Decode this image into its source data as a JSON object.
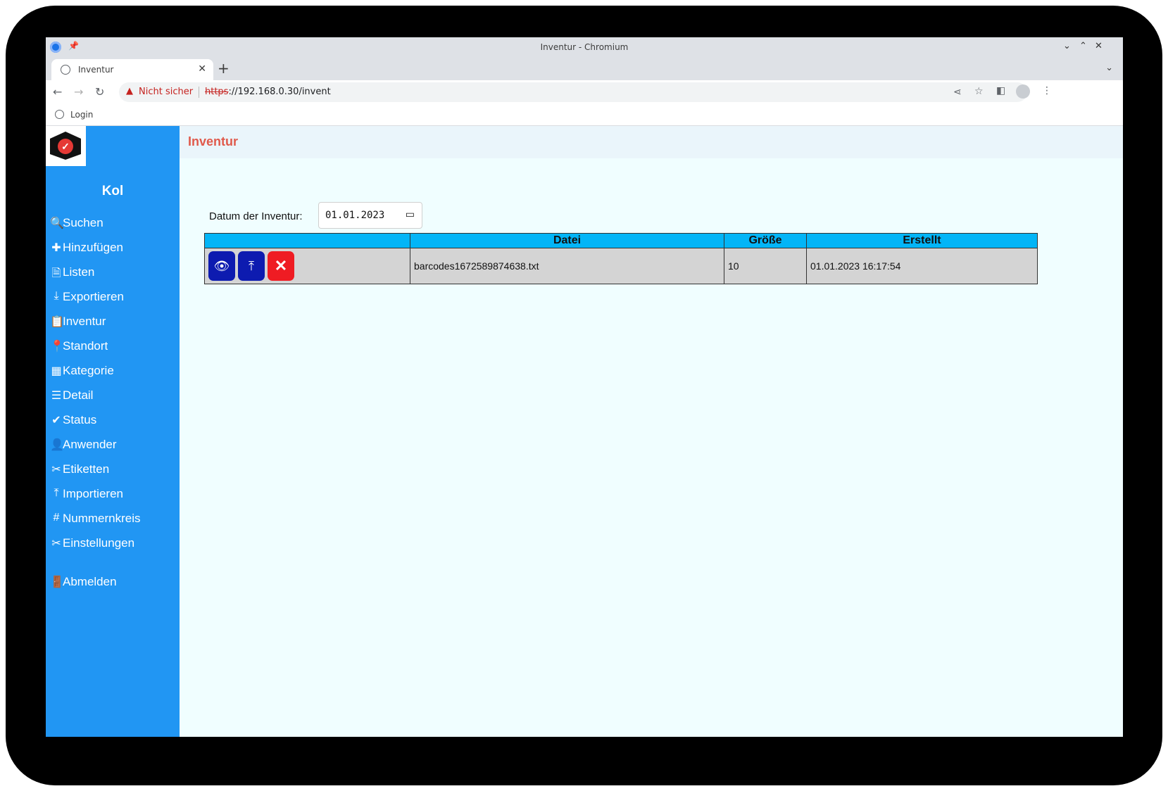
{
  "browser": {
    "window_title": "Inventur - Chromium",
    "tab_title": "Inventur",
    "security_label": "Nicht sicher",
    "url_scheme": "https",
    "url_rest": "://192.168.0.30/invent",
    "bookmark": "Login"
  },
  "sidebar": {
    "brand": "Kol",
    "items": [
      {
        "label": "Suchen",
        "icon": "search-icon",
        "glyph": "🔍"
      },
      {
        "label": "Hinzufügen",
        "icon": "plus-icon",
        "glyph": "✚"
      },
      {
        "label": "Listen",
        "icon": "document-icon",
        "glyph": "🗎"
      },
      {
        "label": "Exportieren",
        "icon": "download-icon",
        "glyph": "⤓"
      },
      {
        "label": "Inventur",
        "icon": "clipboard-icon",
        "glyph": "📋"
      },
      {
        "label": "Standort",
        "icon": "location-pin-icon",
        "glyph": "📍"
      },
      {
        "label": "Kategorie",
        "icon": "grid-icon",
        "glyph": "▦"
      },
      {
        "label": "Detail",
        "icon": "list-icon",
        "glyph": "☰"
      },
      {
        "label": "Status",
        "icon": "check-icon",
        "glyph": "✔"
      },
      {
        "label": "Anwender",
        "icon": "user-icon",
        "glyph": "👤"
      },
      {
        "label": "Etiketten",
        "icon": "tools-icon",
        "glyph": "✂"
      },
      {
        "label": "Importieren",
        "icon": "upload-icon",
        "glyph": "⤒"
      },
      {
        "label": "Nummernkreis",
        "icon": "hash-icon",
        "glyph": "#"
      },
      {
        "label": "Einstellungen",
        "icon": "settings-tools-icon",
        "glyph": "✂"
      },
      {
        "label": "Abmelden",
        "icon": "logout-icon",
        "glyph": "🚪"
      }
    ]
  },
  "main": {
    "title": "Inventur",
    "date_label": "Datum der Inventur:",
    "date_value": "01.01.2023",
    "table": {
      "headers": [
        "",
        "Datei",
        "Größe",
        "Erstellt"
      ],
      "rows": [
        {
          "file": "barcodes1672589874638.txt",
          "size": "10",
          "created": "01.01.2023 16:17:54"
        }
      ]
    }
  },
  "colors": {
    "sidebar": "#2196f3",
    "title": "#e05a4c",
    "table_header": "#03b5f7",
    "delete": "#ef1c23",
    "action": "#0d1bb0"
  }
}
